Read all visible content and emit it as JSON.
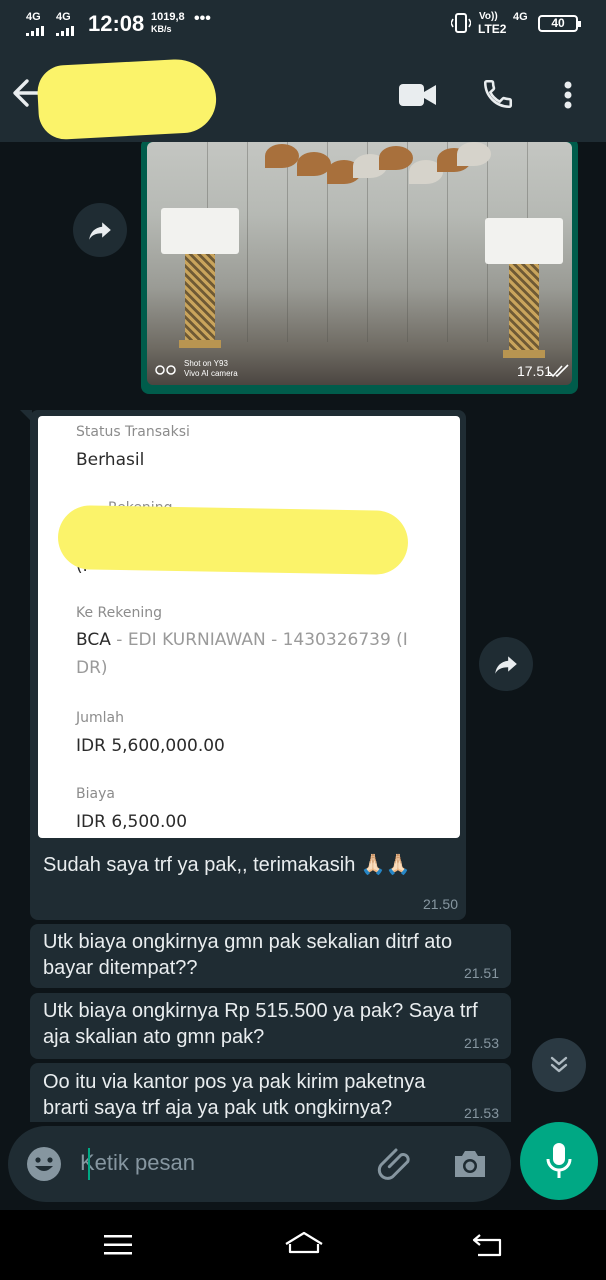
{
  "status_bar": {
    "time": "12:08",
    "signal_1": "4G",
    "signal_2": "4G",
    "speed_value": "1019,8",
    "speed_unit": "KB/s",
    "more": "•••",
    "volte_1": "Vo))",
    "volte_2": "LTE2",
    "signal_3": "4G",
    "battery": "40"
  },
  "header": {
    "contact_name": "",
    "icons": [
      "back-arrow-icon",
      "video-call-icon",
      "phone-call-icon",
      "more-vert-icon"
    ]
  },
  "messages": {
    "image_message": {
      "watermark_line1": "Shot on Y93",
      "watermark_line2": "Vivo AI camera",
      "time": "17.51",
      "status": "read"
    },
    "receipt_message": {
      "receipt": {
        "status_label": "Status Transaksi",
        "status_value": "Berhasil",
        "from_label_fragment": "Rekening",
        "from_value_fragment": "(I",
        "to_label": "Ke Rekening",
        "to_bank": "BCA",
        "to_value_line1": " - EDI KURNIAWAN - 1430326739 (I",
        "to_value_line2": "DR)",
        "amount_label": "Jumlah",
        "amount_value": "IDR 5,600,000.00",
        "fee_label": "Biaya",
        "fee_value": "IDR 6,500.00"
      },
      "caption": "Sudah saya trf ya pak,, terimakasih 🙏🏻🙏🏻",
      "time": "21.50"
    },
    "text_messages": [
      {
        "text": "Utk biaya ongkirnya gmn pak sekalian ditrf ato bayar ditempat??",
        "time": "21.51"
      },
      {
        "text": "Utk biaya ongkirnya Rp 515.500 ya pak? Saya trf aja skalian ato gmn pak?",
        "time": "21.53"
      },
      {
        "text": "Oo itu via kantor pos ya pak kirim paketnya brarti saya trf aja ya pak utk ongkirnya?",
        "time": "21.53"
      }
    ]
  },
  "input": {
    "placeholder": "Ketik pesan"
  },
  "colors": {
    "header_bg": "#1f2c33",
    "chat_bg": "#0d1418",
    "incoming_bubble": "#1f2c33",
    "outgoing_bubble": "#005c4b",
    "accent": "#00a884"
  }
}
